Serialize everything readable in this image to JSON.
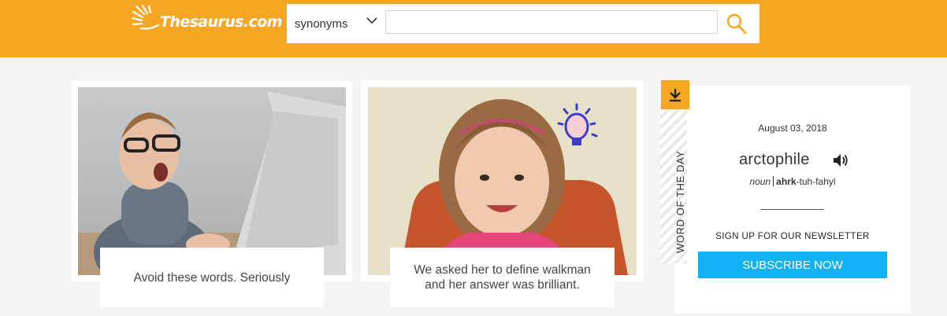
{
  "header": {
    "logo_text": "Thesaurus.com",
    "search": {
      "mode_selected": "synonyms",
      "query_value": "",
      "placeholder": ""
    }
  },
  "cards": [
    {
      "caption": "Avoid these words. Seriously"
    },
    {
      "caption": "We asked her to define walkman and her answer was brilliant."
    }
  ],
  "word_of_the_day": {
    "banner": "WORD OF THE DAY",
    "date": "August 03, 2018",
    "word": "arctophile",
    "part_of_speech": "noun",
    "pron_stressed": "ahrk",
    "pron_rest": "-tuh-fahyl",
    "newsletter_label": "SIGN UP FOR OUR NEWSLETTER",
    "subscribe_label": "SUBSCRIBE NOW"
  },
  "colors": {
    "brand_orange": "#f5a623",
    "subscribe_blue": "#12b2f4",
    "page_bg": "#f4f4f4"
  },
  "icons": {
    "logo": "sunburst-icon",
    "search": "magnifier-icon",
    "dropdown": "chevron-down-icon",
    "download": "download-icon",
    "audio": "speaker-icon"
  }
}
